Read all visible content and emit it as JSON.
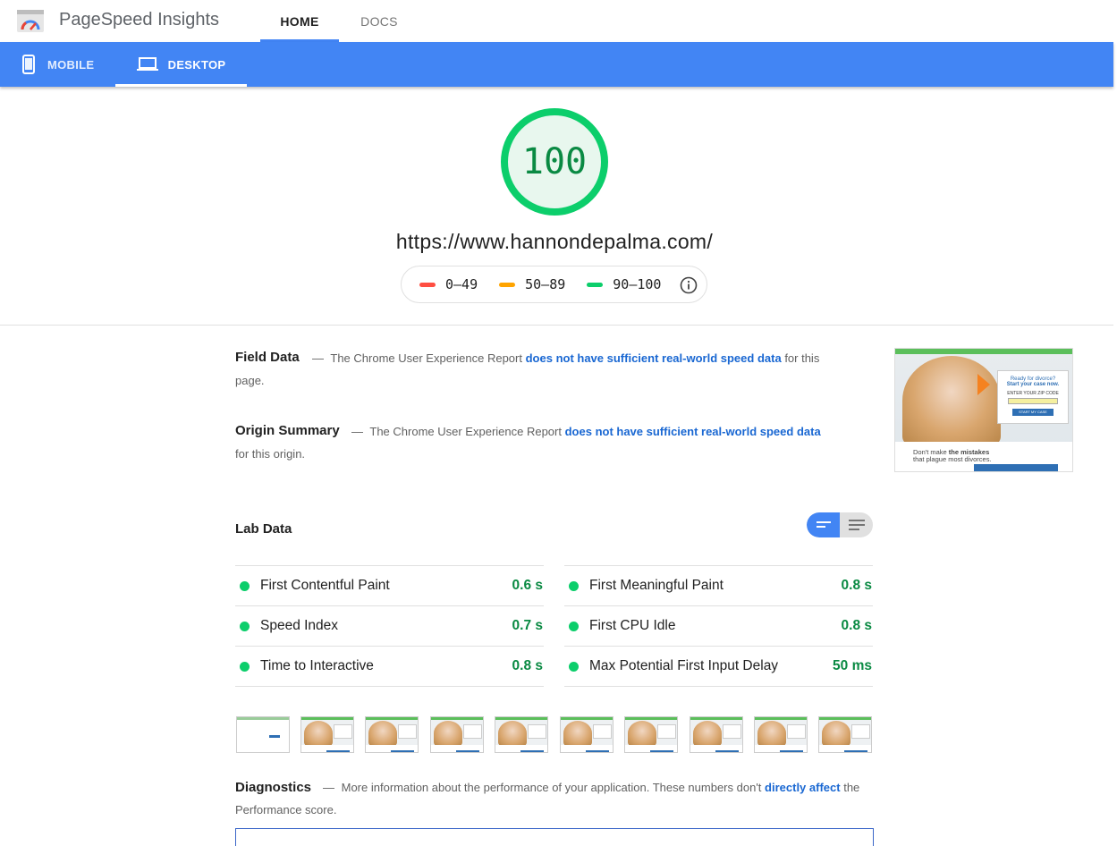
{
  "header": {
    "brand": "PageSpeed Insights",
    "tabs": [
      {
        "label": "HOME",
        "active": true
      },
      {
        "label": "DOCS",
        "active": false
      }
    ]
  },
  "device_tabs": [
    {
      "label": "MOBILE",
      "icon": "phone-icon",
      "active": false
    },
    {
      "label": "DESKTOP",
      "icon": "laptop-icon",
      "active": true
    }
  ],
  "score": {
    "value": "100",
    "fraction": 1.0,
    "color": "#0cce6b",
    "url": "https://www.hannondepalma.com/"
  },
  "legend": [
    {
      "range": "0–49",
      "color": "#ff4e42"
    },
    {
      "range": "50–89",
      "color": "#ffa400"
    },
    {
      "range": "90–100",
      "color": "#0cce6b"
    }
  ],
  "field_data": {
    "title": "Field Data",
    "dash": "—",
    "prefix": "The Chrome User Experience Report",
    "link": "does not have sufficient real-world speed data",
    "suffix": "for this page."
  },
  "origin_summary": {
    "title": "Origin Summary",
    "dash": "—",
    "prefix": "The Chrome User Experience Report",
    "link": "does not have sufficient real-world speed data",
    "suffix": "for this origin."
  },
  "screenshot": {
    "top_text": "",
    "card_line1": "Ready for divorce?",
    "card_line2": "Start your case now.",
    "card_field": "ENTER YOUR ZIP CODE",
    "card_button": "START MY CASE",
    "caption_a": "Don't make ",
    "caption_b": "the mistakes",
    "caption_c": "that plague most divorces."
  },
  "lab_data": {
    "title": "Lab Data",
    "left": [
      {
        "name": "First Contentful Paint",
        "value": "0.6 s"
      },
      {
        "name": "Speed Index",
        "value": "0.7 s"
      },
      {
        "name": "Time to Interactive",
        "value": "0.8 s"
      }
    ],
    "right": [
      {
        "name": "First Meaningful Paint",
        "value": "0.8 s"
      },
      {
        "name": "First CPU Idle",
        "value": "0.8 s"
      },
      {
        "name": "Max Potential First Input Delay",
        "value": "50 ms"
      }
    ]
  },
  "diagnostics": {
    "title": "Diagnostics",
    "dash": "—",
    "prefix": "More information about the performance of your application. These numbers don't",
    "link": "directly affect",
    "suffix": "the Performance score."
  }
}
